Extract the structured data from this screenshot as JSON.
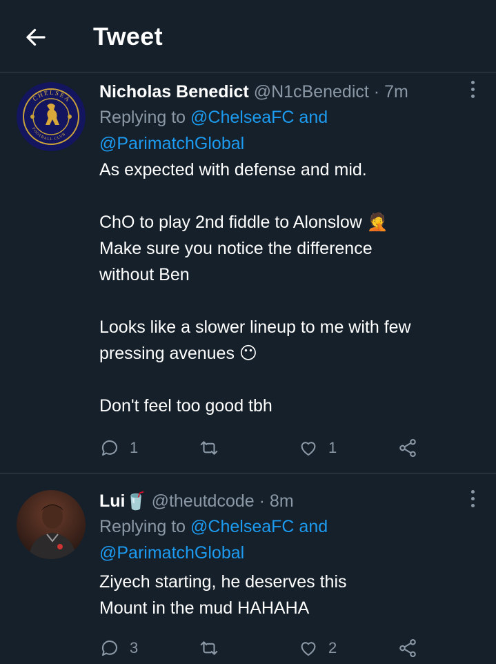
{
  "header": {
    "title": "Tweet"
  },
  "tweets": [
    {
      "name": "Nicholas Benedict",
      "handle": "@N1cBenedict",
      "separator": "·",
      "time": "7m",
      "replying_prefix": "Replying to",
      "reply_to_1": "@ChelseaFC",
      "reply_and": "and",
      "reply_to_2": "@ParimatchGlobal",
      "lines": [
        "As expected with defense and mid.",
        "",
        "ChO to play 2nd fiddle to Alonslow 🤦",
        "Make sure you notice the difference",
        "without Ben",
        "",
        "Looks like a slower lineup to me with few",
        "pressing avenues 😶",
        "",
        "Don't feel too good tbh"
      ],
      "reply_count": "1",
      "retweet_count": "",
      "like_count": "1",
      "avatar_logo_text": "CHELSEA FOOTBALL CLUB"
    },
    {
      "name": "Lui🥤",
      "handle": "@theutdcode",
      "separator": "·",
      "time": "8m",
      "replying_prefix": "Replying to",
      "reply_to_1": "@ChelseaFC",
      "reply_and": "and",
      "reply_to_2": "@ParimatchGlobal",
      "lines": [
        "Ziyech starting, he deserves this",
        "Mount in the mud HAHAHA"
      ],
      "reply_count": "3",
      "retweet_count": "",
      "like_count": "2"
    }
  ],
  "icons": {
    "back": "arrow-left-icon",
    "more": "more-vertical-icon",
    "reply": "reply-icon",
    "retweet": "retweet-icon",
    "like": "heart-icon",
    "share": "share-icon"
  },
  "colors": {
    "background": "#15202b",
    "divider": "#38444d",
    "text": "#ffffff",
    "muted": "#8b98a5",
    "link": "#1d9bf0"
  }
}
